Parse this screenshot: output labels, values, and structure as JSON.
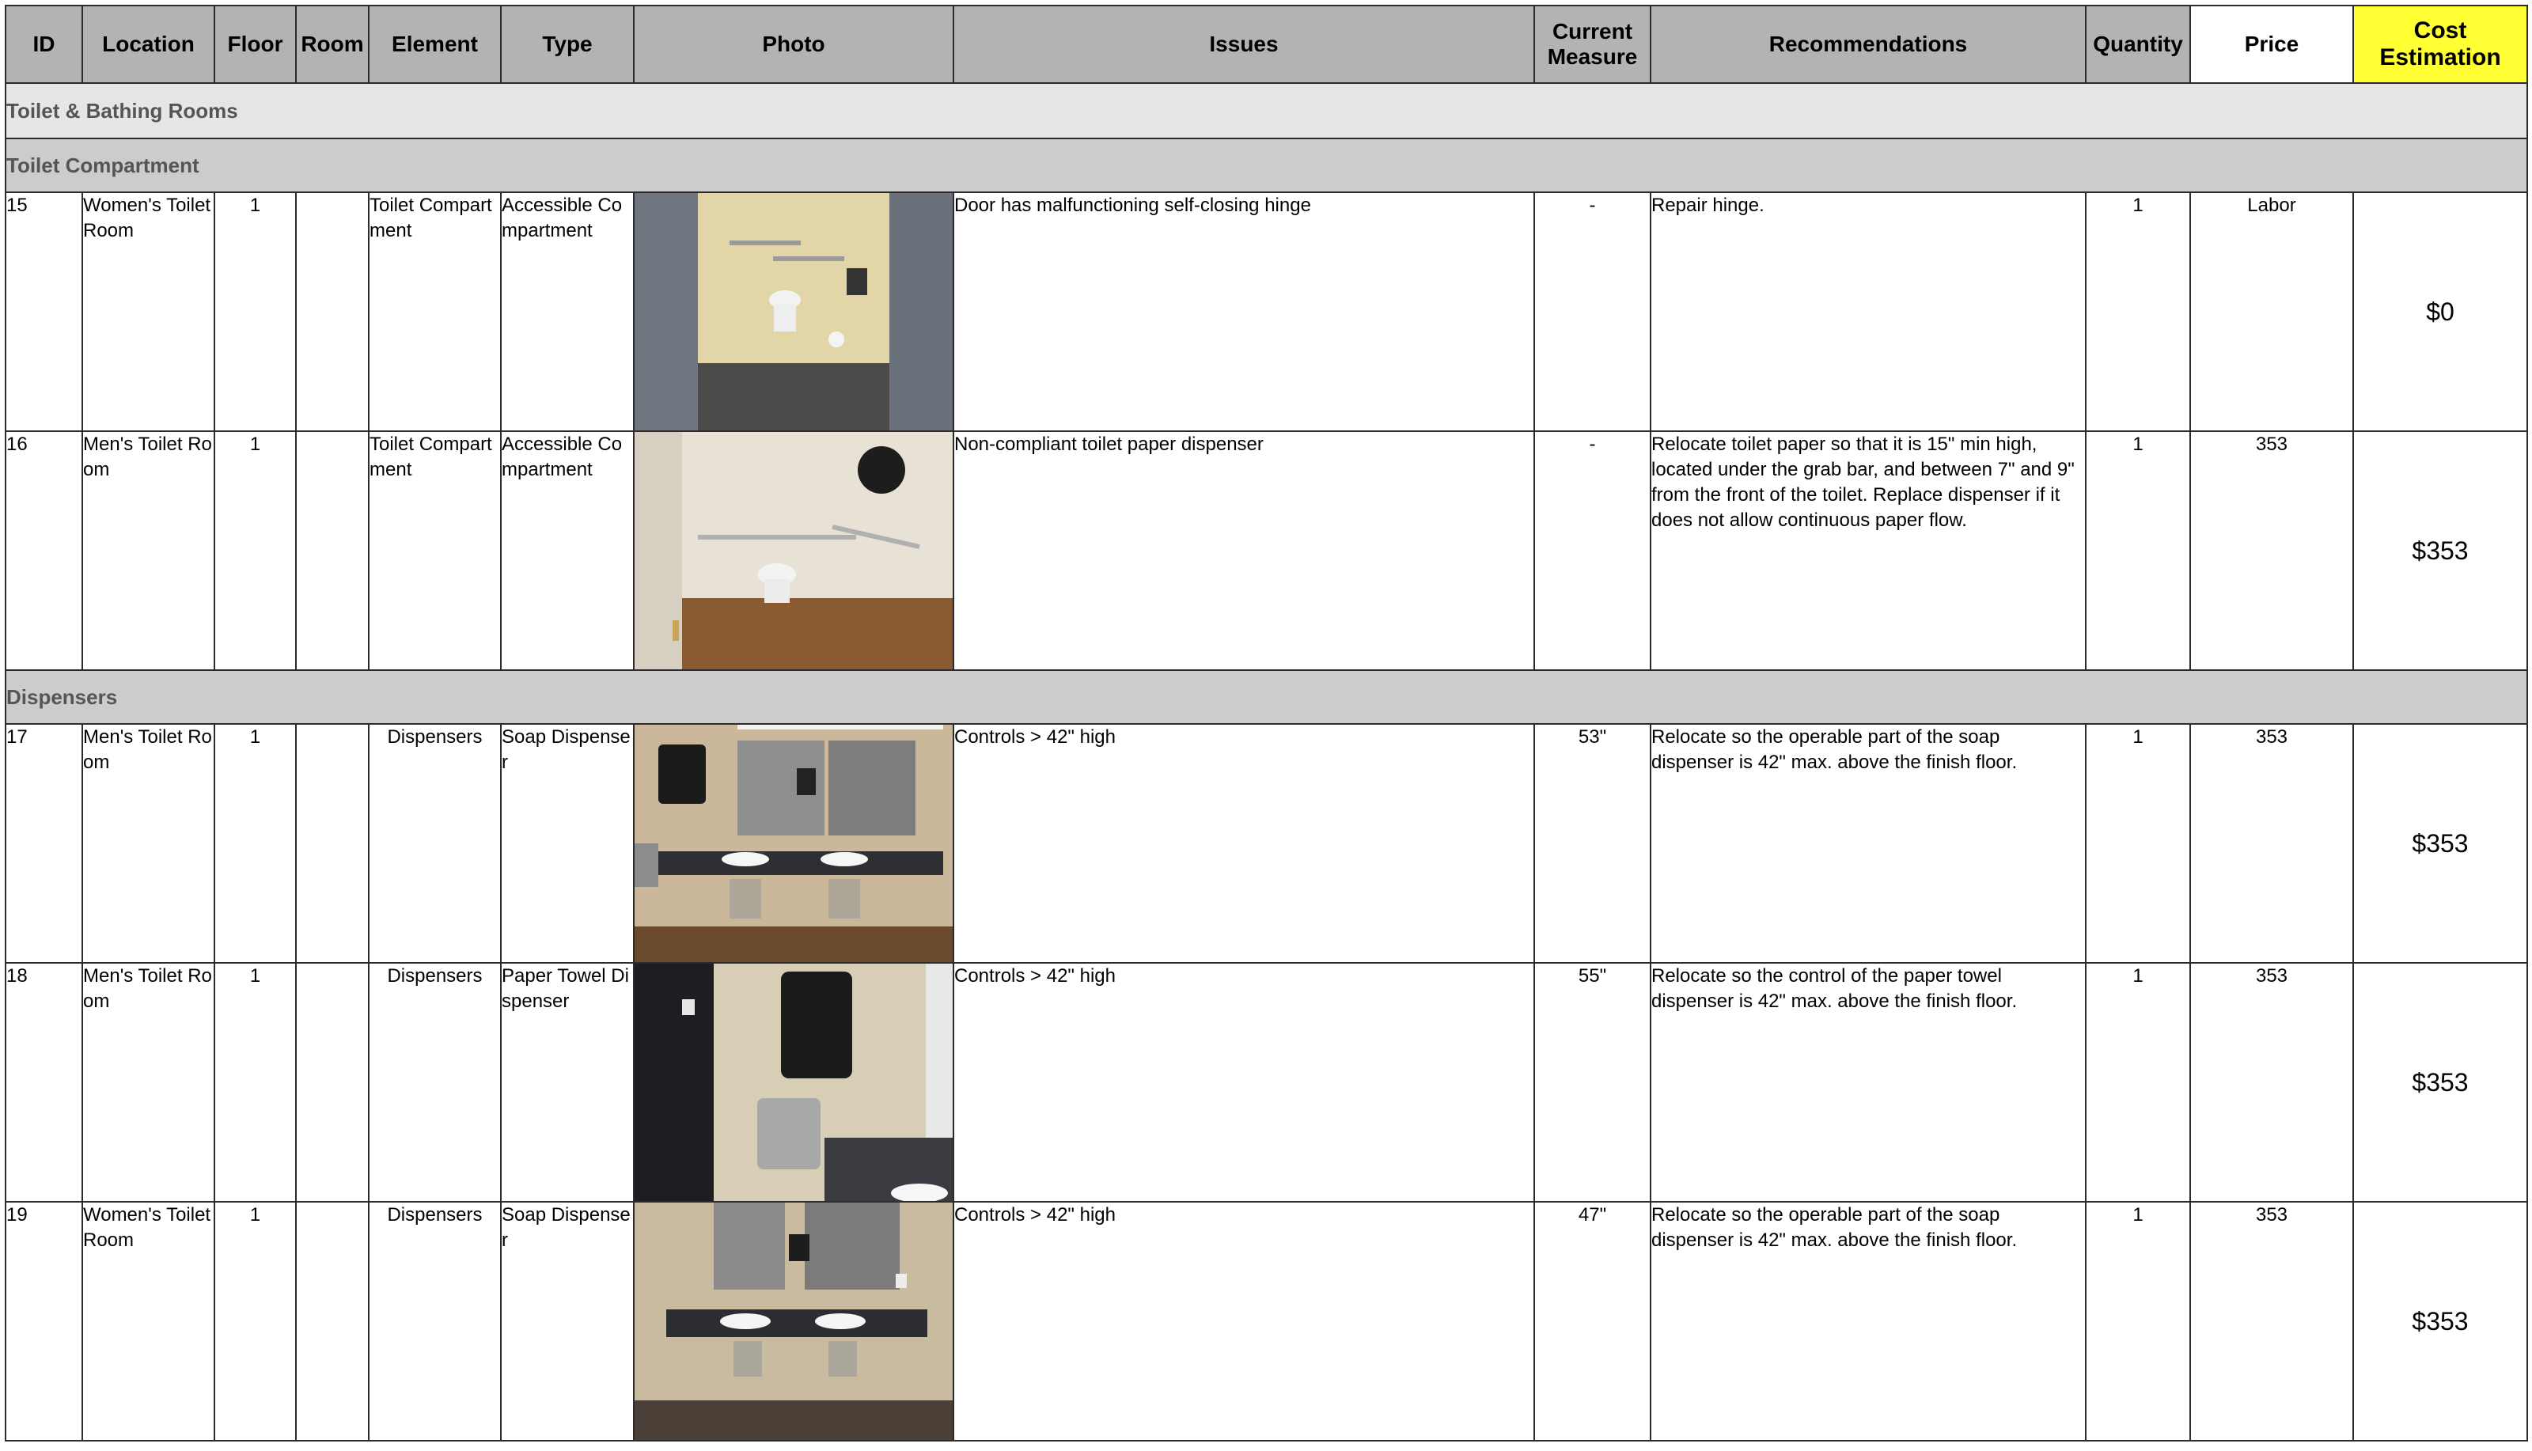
{
  "headers": {
    "id": "ID",
    "location": "Location",
    "floor": "Floor",
    "room": "Room",
    "element": "Element",
    "type": "Type",
    "photo": "Photo",
    "issues": "Issues",
    "current_measure_line1": "Current",
    "current_measure_line2": "Measure",
    "recommendations": "Recommendations",
    "quantity": "Quantity",
    "price": "Price",
    "cost_line1": "Cost",
    "cost_line2": "Estimation"
  },
  "sections": {
    "toilet_bathing": "Toilet & Bathing Rooms",
    "toilet_compartment": "Toilet Compartment",
    "dispensers": "Dispensers"
  },
  "rows": [
    {
      "id": "15",
      "location": "Women's Toilet Room",
      "floor": "1",
      "room": "",
      "element": "Toilet Compartment",
      "type": "Accessible Compartment",
      "photo": "toilet-stall-photo",
      "issue": "Door has malfunctioning self-closing hinge",
      "measure": "-",
      "recommendation": "Repair hinge.",
      "quantity": "1",
      "price": "Labor",
      "cost": "$0"
    },
    {
      "id": "16",
      "location": "Men's Toilet Room",
      "floor": "1",
      "room": "",
      "element": "Toilet Compartment",
      "type": "Accessible Compartment",
      "photo": "toilet-paper-dispenser-photo",
      "issue": "Non-compliant toilet paper dispenser",
      "measure": "-",
      "recommendation": "Relocate toilet paper so that it is 15\" min high, located under the grab bar, and between 7\" and 9\" from the front of the toilet. Replace dispenser if it does not allow continuous paper flow.",
      "quantity": "1",
      "price": "353",
      "cost": "$353"
    },
    {
      "id": "17",
      "location": "Men's Toilet Room",
      "floor": "1",
      "room": "",
      "element": "Dispensers",
      "type": "Soap Dispenser",
      "photo": "sink-counter-photo",
      "issue": "Controls > 42\" high",
      "measure": "53\"",
      "recommendation": "Relocate so the operable part of the soap dispenser is 42\" max. above the finish floor.",
      "quantity": "1",
      "price": "353",
      "cost": "$353"
    },
    {
      "id": "18",
      "location": "Men's Toilet Room",
      "floor": "1",
      "room": "",
      "element": "Dispensers",
      "type": "Paper Towel Dispenser",
      "photo": "paper-towel-dispenser-photo",
      "issue": "Controls > 42\" high",
      "measure": "55\"",
      "recommendation": "Relocate so the control of the paper towel dispenser is 42\" max. above the finish floor.",
      "quantity": "1",
      "price": "353",
      "cost": "$353"
    },
    {
      "id": "19",
      "location": "Women's Toilet Room",
      "floor": "1",
      "room": "",
      "element": "Dispensers",
      "type": "Soap Dispenser",
      "photo": "women-sink-counter-photo",
      "issue": "Controls > 42\" high",
      "measure": "47\"",
      "recommendation": "Relocate so the operable part of the soap dispenser is 42\" max. above the finish floor.",
      "quantity": "1",
      "price": "353",
      "cost": "$353"
    }
  ],
  "colors": {
    "header_bg": "#b3b3b3",
    "cost_header_bg": "#ffff33",
    "section_bg": "#e6e6e6",
    "subsection_bg": "#cccccc"
  }
}
